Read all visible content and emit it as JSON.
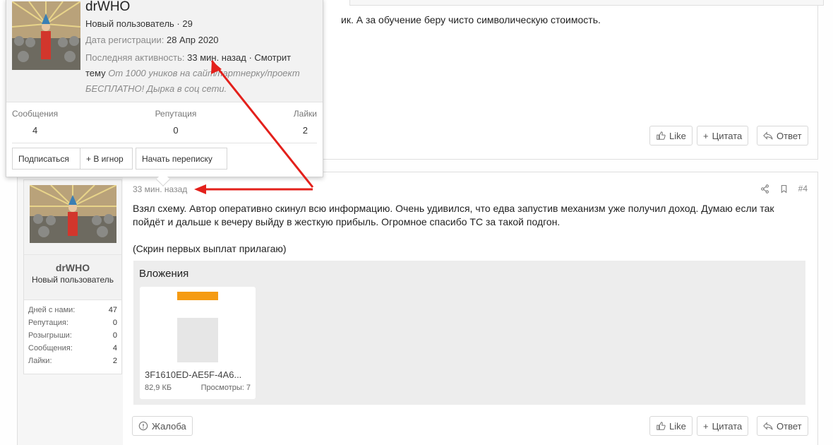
{
  "prev_post": {
    "text_fragment": "ик. А за обучение беру чисто символическую стоимость.",
    "like_label": "Like",
    "quote_label": "Цитата",
    "reply_label": "Ответ"
  },
  "post": {
    "time": "33 мин. назад",
    "number": "#4",
    "body_line1": "Взял схему. Автор оперативно скинул всю информацию. Очень удивился, что едва запустив механизм уже получил доход. Думаю если так",
    "body_line2": "пойдёт и дальше к вечеру выйду в жесткую прибыль. Огромное спасибо ТС за такой подгон.",
    "body_line3": "(Скрин первых выплат прилагаю)",
    "attachments_title": "Вложения",
    "attachment": {
      "filename": "3F1610ED-AE5F-4A6...",
      "size": "82,9 КБ",
      "views": "Просмотры: 7"
    },
    "report_label": "Жалоба",
    "like_label": "Like",
    "quote_label": "Цитата",
    "reply_label": "Ответ"
  },
  "user": {
    "name": "drWHO",
    "title": "Новый пользователь",
    "stats": [
      {
        "label": "Дней с нами:",
        "value": "47"
      },
      {
        "label": "Репутация:",
        "value": "0"
      },
      {
        "label": "Розыгрыши:",
        "value": "0"
      },
      {
        "label": "Сообщения:",
        "value": "4"
      },
      {
        "label": "Лайки:",
        "value": "2"
      }
    ]
  },
  "popup": {
    "name": "drWHO",
    "title_line": "Новый пользователь · 29",
    "reg_label": "Дата регистрации:",
    "reg_value": "28 Апр 2020",
    "activity_label": "Последняя активность:",
    "activity_value": "33 мин. назад · Смотрит",
    "activity_word": "тему",
    "activity_topic": "От 1000 уников на сайт/партнерку/проект БЕСПЛАТНО! Дырка в соц сети.",
    "stats": [
      {
        "label": "Сообщения",
        "value": "4"
      },
      {
        "label": "Репутация",
        "value": "0"
      },
      {
        "label": "Лайки",
        "value": "2"
      }
    ],
    "subscribe_label": "Подписаться",
    "ignore_label": "+ В игнор",
    "message_label": "Начать переписку"
  },
  "colors": {
    "arrow": "#e3201b",
    "accent_orange": "#f59b13"
  }
}
